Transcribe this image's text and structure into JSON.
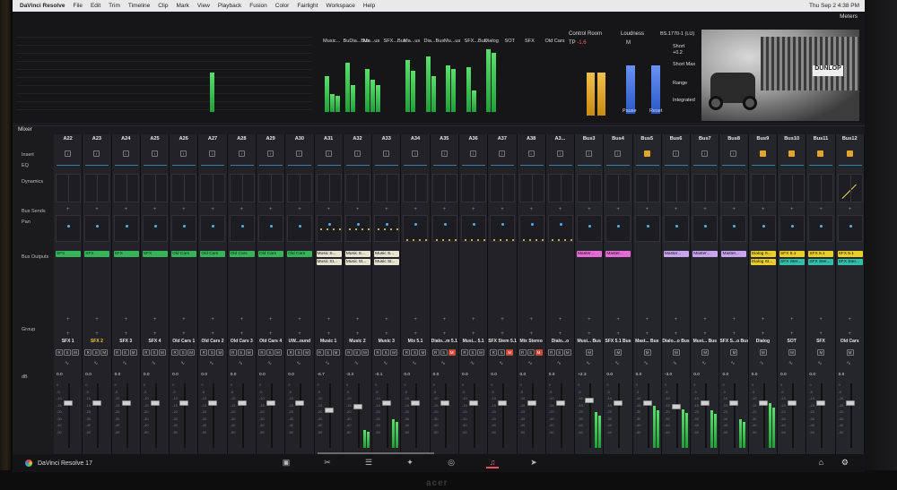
{
  "menubar": {
    "items": [
      "DaVinci Resolve",
      "File",
      "Edit",
      "Trim",
      "Timeline",
      "Clip",
      "Mark",
      "View",
      "Playback",
      "Fusion",
      "Color",
      "Fairlight",
      "Workspace",
      "Help"
    ],
    "clock": "Thu Sep 2  4:38 PM"
  },
  "meters_panel": {
    "title": "Meters",
    "bus_labels": [
      "Music...",
      "BuDia...Bus",
      "Mu...us",
      "SFX...Bus",
      "Ma...us",
      "Dia...Bus",
      "Mu...us",
      "SFX...Bus",
      "Dialog",
      "SOT",
      "SFX",
      "Old Cars"
    ],
    "control_room": {
      "title": "Control Room",
      "tp_label": "TP",
      "tp_value": "-1.6"
    },
    "loudness": {
      "title": "Loudness",
      "m_label": "M",
      "standard": "BS.1770-1 (LU)",
      "short_label": "Short",
      "short_value": "+0.2",
      "short_max_label": "Short Max",
      "range_label": "Range",
      "integrated_label": "Integrated",
      "pause_label": "Pause",
      "reset_label": "Reset"
    },
    "video_sign": "DUNLOP"
  },
  "mixer": {
    "title": "Mixer",
    "row_labels": {
      "insert": "Insert",
      "eq": "EQ",
      "dynamics": "Dynamics",
      "bus_sends": "Bus Sends",
      "pan": "Pan",
      "bus_outputs": "Bus Outputs",
      "group": "Group",
      "db": "dB"
    },
    "strips": [
      {
        "id": "A22",
        "track": "SFX 1",
        "out": [
          "SFX"
        ],
        "outc": [
          "green"
        ],
        "vol": "0.0",
        "knob": 0.3,
        "lvl": 0
      },
      {
        "id": "A23",
        "track": "SFX 2",
        "out": [
          "SFX"
        ],
        "outc": [
          "green"
        ],
        "vol": "0.0",
        "knob": 0.3,
        "lvl": 0,
        "hl": true
      },
      {
        "id": "A24",
        "track": "SFX 3",
        "out": [
          "SFX"
        ],
        "outc": [
          "green"
        ],
        "vol": "0.0",
        "knob": 0.3,
        "lvl": 0
      },
      {
        "id": "A25",
        "track": "SFX 4",
        "out": [
          "SFX"
        ],
        "outc": [
          "green"
        ],
        "vol": "0.0",
        "knob": 0.3,
        "lvl": 0
      },
      {
        "id": "A26",
        "track": "Old Cars 1",
        "out": [
          "Old Cars"
        ],
        "outc": [
          "green"
        ],
        "vol": "0.0",
        "knob": 0.3,
        "lvl": 0
      },
      {
        "id": "A27",
        "track": "Old Cars 2",
        "out": [
          "Old Cars"
        ],
        "outc": [
          "green"
        ],
        "vol": "0.0",
        "knob": 0.3,
        "lvl": 0
      },
      {
        "id": "A28",
        "track": "Old Cars 3",
        "out": [
          "Old Cars"
        ],
        "outc": [
          "green"
        ],
        "vol": "0.0",
        "knob": 0.3,
        "lvl": 0
      },
      {
        "id": "A29",
        "track": "Old Cars 4",
        "out": [
          "Old Cars"
        ],
        "outc": [
          "green"
        ],
        "vol": "0.0",
        "knob": 0.3,
        "lvl": 0
      },
      {
        "id": "A30",
        "track": "UW...ound",
        "out": [
          "Old Cars"
        ],
        "outc": [
          "green"
        ],
        "vol": "0.0",
        "knob": 0.3,
        "lvl": 0
      },
      {
        "id": "A31",
        "track": "Music 1",
        "out": [
          "Music S...",
          "Music St..."
        ],
        "outc": [
          "white",
          "white"
        ],
        "vol": "-6.7",
        "knob": 0.42,
        "lvl": 0
      },
      {
        "id": "A32",
        "track": "Music 2",
        "out": [
          "Music S...",
          "Music St..."
        ],
        "outc": [
          "white",
          "white"
        ],
        "vol": "-3.3",
        "knob": 0.36,
        "lvl": 0.28
      },
      {
        "id": "A33",
        "track": "Music 3",
        "out": [
          "Music S...",
          "Music St..."
        ],
        "outc": [
          "white",
          "white"
        ],
        "vol": "-0.1",
        "knob": 0.3,
        "lvl": 0.45
      },
      {
        "id": "A34",
        "track": "Mix 5.1",
        "out": [],
        "outc": [],
        "vol": "0.0",
        "knob": 0.3,
        "lvl": 0
      },
      {
        "id": "A35",
        "track": "Dialo...m 5.1",
        "out": [],
        "outc": [],
        "vol": "0.0",
        "knob": 0.3,
        "lvl": 0
      },
      {
        "id": "A36",
        "track": "Musi... 5.1",
        "out": [],
        "outc": [],
        "vol": "0.0",
        "knob": 0.3,
        "lvl": 0
      },
      {
        "id": "A37",
        "track": "SFX Stem 5.1",
        "out": [],
        "outc": [],
        "vol": "0.0",
        "knob": 0.3,
        "lvl": 0
      },
      {
        "id": "A38",
        "track": "Mix Stereo",
        "out": [],
        "outc": [],
        "vol": "0.0",
        "knob": 0.3,
        "lvl": 0
      },
      {
        "id": "A3...",
        "track": "Dialo...o",
        "out": [],
        "outc": [],
        "vol": "0.0",
        "knob": 0.3,
        "lvl": 0
      },
      {
        "id": "Bus3",
        "track": "Musi... Bus",
        "out": [
          "Master..."
        ],
        "outc": [
          "pink"
        ],
        "vol": "+2.3",
        "knob": 0.25,
        "lvl": 0.55,
        "bus": true
      },
      {
        "id": "Bus4",
        "track": "SFX 5.1 Bus",
        "out": [
          "Master..."
        ],
        "outc": [
          "pink"
        ],
        "vol": "0.0",
        "knob": 0.3,
        "lvl": 0,
        "bus": true
      },
      {
        "id": "Bus5",
        "track": "Mast... Bus",
        "out": [],
        "outc": [],
        "vol": "0.0",
        "knob": 0.3,
        "lvl": 0.65,
        "bus": true,
        "ins": true
      },
      {
        "id": "Bus6",
        "track": "Dialo...o Bus",
        "out": [
          "Master..."
        ],
        "outc": [
          "purple"
        ],
        "vol": "-3.0",
        "knob": 0.36,
        "lvl": 0.6,
        "bus": true
      },
      {
        "id": "Bus7",
        "track": "Musi... Bus",
        "out": [
          "Master..."
        ],
        "outc": [
          "purple"
        ],
        "vol": "0.0",
        "knob": 0.3,
        "lvl": 0.58,
        "bus": true
      },
      {
        "id": "Bus8",
        "track": "SFX S...o Bus",
        "out": [
          "Master..."
        ],
        "outc": [
          "purple"
        ],
        "vol": "0.0",
        "knob": 0.3,
        "lvl": 0.45,
        "bus": true
      },
      {
        "id": "Bus9",
        "track": "Dialog",
        "out": [
          "Dialog S...",
          "Dialog St..."
        ],
        "outc": [
          "yellow",
          "yellow"
        ],
        "vol": "0.0",
        "knob": 0.3,
        "lvl": 0.7,
        "bus": true,
        "ins": true
      },
      {
        "id": "Bus10",
        "track": "SOT",
        "out": [
          "SFX 5.1",
          "SFX Ster..."
        ],
        "outc": [
          "yellow",
          "teal"
        ],
        "vol": "0.0",
        "knob": 0.3,
        "lvl": 0,
        "bus": true,
        "ins": true
      },
      {
        "id": "Bus11",
        "track": "SFX",
        "out": [
          "SFX 5.1",
          "SFX Ster..."
        ],
        "outc": [
          "yellow",
          "teal"
        ],
        "vol": "0.0",
        "knob": 0.3,
        "lvl": 0,
        "bus": true,
        "ins": true
      },
      {
        "id": "Bus12",
        "track": "Old Cars",
        "out": [
          "SFX 5.1",
          "SFX Ster..."
        ],
        "outc": [
          "yellow",
          "teal"
        ],
        "vol": "0.0",
        "knob": 0.3,
        "lvl": 0,
        "bus": true,
        "ins": true,
        "ramp": true
      }
    ]
  },
  "dock": {
    "app_label": "DaVinci Resolve 17",
    "pages": [
      "media-icon",
      "cut-icon",
      "edit-icon",
      "fusion-icon",
      "color-icon",
      "fairlight-icon",
      "deliver-icon"
    ],
    "active_page": 5
  },
  "monitor_brand": "acer"
}
